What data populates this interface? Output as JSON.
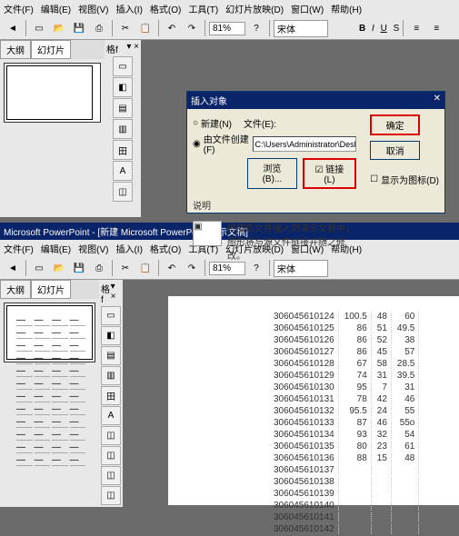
{
  "top": {
    "menubar": [
      "文件(F)",
      "编辑(E)",
      "视图(V)",
      "插入(I)",
      "格式(O)",
      "工具(T)",
      "幻灯片放映(D)",
      "窗口(W)",
      "帮助(H)"
    ],
    "zoom": "81%",
    "font": "宋体",
    "tabs": [
      "大纲",
      "幻灯片"
    ],
    "mid_hdr": "格f",
    "dialog": {
      "title": "插入对象",
      "opt_new": "新建(N)",
      "opt_file": "由文件创建(F)",
      "file_label": "文件(E):",
      "file_path": "C:\\Users\\Administrator\\Desktop\\如何在PowerPo",
      "browse": "浏览(B)...",
      "link": "链接(L)",
      "ok": "确定",
      "cancel": "取消",
      "show_icon": "显示为图标(D)",
      "desc_label": "说明",
      "desc": "将图形文件插入到演示文稿中，图形将与源文件链接并随之修改。"
    }
  },
  "bot": {
    "title": "Microsoft PowerPoint - [新建 Microsoft PowerPoint 演示文稿]",
    "menubar": [
      "文件(F)",
      "编辑(E)",
      "视图(V)",
      "插入(I)",
      "格式(O)",
      "工具(T)",
      "幻灯片放映(D)",
      "窗口(W)",
      "帮助(H)"
    ],
    "zoom": "81%",
    "font": "宋体",
    "tabs": [
      "大纲",
      "幻灯片"
    ],
    "mid_hdr": "格f"
  },
  "chart_data": {
    "type": "table",
    "columns": [
      "id",
      "c1",
      "c2",
      "c3"
    ],
    "rows": [
      [
        "306045610124",
        "100.5",
        "48",
        "60"
      ],
      [
        "306045610125",
        "86",
        "51",
        "49.5"
      ],
      [
        "306045610126",
        "86",
        "52",
        "38"
      ],
      [
        "306045610127",
        "86",
        "45",
        "57"
      ],
      [
        "306045610128",
        "67",
        "58",
        "28.5"
      ],
      [
        "306045610129",
        "74",
        "31",
        "39.5"
      ],
      [
        "306045610130",
        "95",
        "7",
        "31"
      ],
      [
        "306045610131",
        "78",
        "42",
        "46"
      ],
      [
        "306045610132",
        "95.5",
        "24",
        "55"
      ],
      [
        "306045610133",
        "87",
        "46",
        "55o"
      ],
      [
        "306045610134",
        "93",
        "32",
        "54"
      ],
      [
        "306045610135",
        "80",
        "23",
        "61"
      ],
      [
        "306045610136",
        "88",
        "15",
        "48"
      ],
      [
        "306045610137",
        "",
        "",
        ""
      ],
      [
        "306045610138",
        "",
        "",
        ""
      ],
      [
        "306045610139",
        "",
        "",
        ""
      ],
      [
        "306045610140",
        "",
        "",
        ""
      ],
      [
        "306045610141",
        "",
        "",
        ""
      ],
      [
        "306045610142",
        "",
        "",
        ""
      ]
    ]
  }
}
